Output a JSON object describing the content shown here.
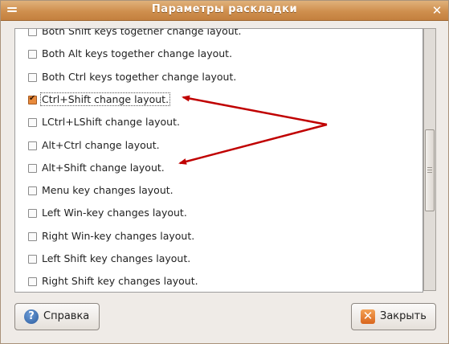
{
  "window": {
    "title": "Параметры раскладки"
  },
  "options": [
    {
      "label": "Both Shift keys together change layout.",
      "checked": false,
      "focused": false
    },
    {
      "label": "Both Alt keys together change layout.",
      "checked": false,
      "focused": false
    },
    {
      "label": "Both Ctrl keys together change layout.",
      "checked": false,
      "focused": false
    },
    {
      "label": "Ctrl+Shift change layout.",
      "checked": true,
      "focused": true
    },
    {
      "label": "LCtrl+LShift change layout.",
      "checked": false,
      "focused": false
    },
    {
      "label": "Alt+Ctrl change layout.",
      "checked": false,
      "focused": false
    },
    {
      "label": "Alt+Shift change layout.",
      "checked": false,
      "focused": false
    },
    {
      "label": "Menu key changes layout.",
      "checked": false,
      "focused": false
    },
    {
      "label": "Left Win-key changes layout.",
      "checked": false,
      "focused": false
    },
    {
      "label": "Right Win-key changes layout.",
      "checked": false,
      "focused": false
    },
    {
      "label": "Left Shift key changes layout.",
      "checked": false,
      "focused": false
    },
    {
      "label": "Right Shift key changes layout.",
      "checked": false,
      "focused": false
    }
  ],
  "buttons": {
    "help_label": "Справка",
    "close_label": "Закрыть"
  },
  "annotation_color": "#c00000",
  "accent_color": "#cf8f4e"
}
